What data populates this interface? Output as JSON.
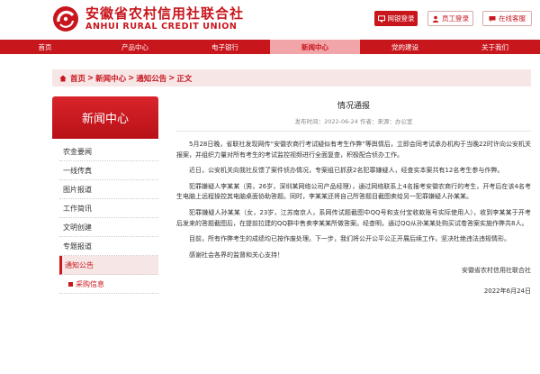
{
  "header": {
    "brand_cn": "安徽省农村信用社联合社",
    "brand_en": "ANHUI RURAL CREDIT UNION",
    "buttons": {
      "login": "网银登录",
      "staff": "员工登录",
      "feedback": "在线客服"
    }
  },
  "nav": {
    "items": [
      "首页",
      "产品中心",
      "电子银行",
      "新闻中心",
      "党的建设",
      "关于我们"
    ],
    "active_index": 3
  },
  "breadcrumb": {
    "items": [
      "首页",
      "新闻中心",
      "通知公告",
      "正文"
    ],
    "separator": ">"
  },
  "sidebar": {
    "title": "新闻中心",
    "items": [
      "农金要闻",
      "一线传真",
      "图片报道",
      "工作简讯",
      "文明创建",
      "专题报道",
      "通知公告",
      "采购信息"
    ],
    "active": "通知公告"
  },
  "article": {
    "title": "情况通报",
    "meta": "发布时间：2022-06-24 作者：来源：办公室",
    "paragraphs": [
      "5月28日晚，省联社发现网传“安徽农商行考试疑似有考生作弊”等舆情后，立即会同考试承办机构于当晚22时许向公安机关报案，并组织力量对所有考生的考试监控视频进行全面复查，积极配合侦办工作。",
      "近日，公安机关向我社反馈了案件侦办情况，专案组已抓获2名犯罪嫌疑人，经查实本案共有12名考生参与作弊。",
      "犯罪嫌疑人李某某（男，26岁，深圳某网络公司产品经理），通过网络联系上4名报考安徽农商行的考生，开考后在该4名考生电脑上远程操控其电脑桌面协助答题。同时，李某某还将自己所答题目截图卖给另一犯罪嫌疑人孙某某。",
      "犯罪嫌疑人孙某某（女，23岁，江苏南京人，系网传试题截图中QQ号和支付宝收款账号实际使用人），收到李某某于开考后发来的答题截图后，在提前拉建的QQ群中售卖李某某所做答案。经查明，通过QQ从孙某某处购买试卷答案实施作弊共8人。",
      "目前，所有作弊考生的成绩均已按作废处理。下一步，我们将公开公平公正开展后续工作，坚决杜绝违法违规情形。",
      "感谢社会各界的监督和关心支持！"
    ],
    "signature": "安徽省农村信用社联合社",
    "date": "2022年6月24日"
  },
  "colors": {
    "brand_red": "#c8161d",
    "nav_active_bg": "#f2a5a8",
    "crumb_bg": "#f7e6e6"
  }
}
